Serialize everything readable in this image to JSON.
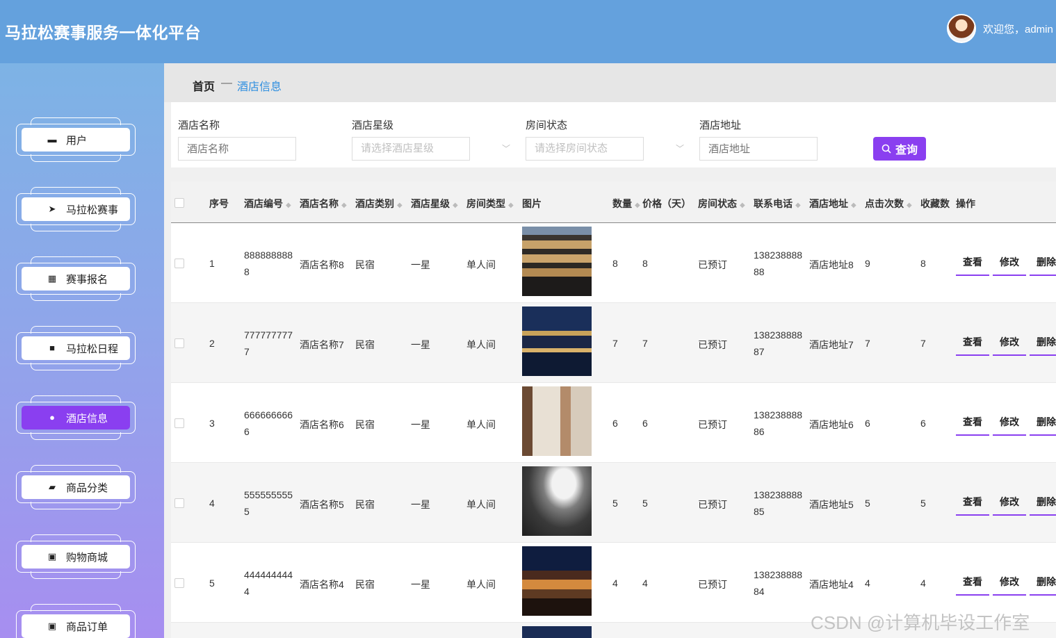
{
  "header": {
    "title": "马拉松赛事服务一体化平台",
    "welcome": "欢迎您，admin"
  },
  "sidebar": {
    "items": [
      {
        "label": "用户",
        "icon": "user-card-icon"
      },
      {
        "label": "马拉松赛事",
        "icon": "paper-plane-icon"
      },
      {
        "label": "赛事报名",
        "icon": "grid-icon"
      },
      {
        "label": "马拉松日程",
        "icon": "four-squares-icon"
      },
      {
        "label": "酒店信息",
        "icon": "person-icon",
        "active": true
      },
      {
        "label": "商品分类",
        "icon": "wallet-icon"
      },
      {
        "label": "购物商城",
        "icon": "clipboard-x-icon"
      },
      {
        "label": "商品订单",
        "icon": "clipboard-check-icon"
      }
    ]
  },
  "breadcrumb": {
    "home": "首页",
    "separator": "—",
    "current": "酒店信息"
  },
  "search": {
    "name_label": "酒店名称",
    "name_placeholder": "酒店名称",
    "star_label": "酒店星级",
    "star_placeholder": "请选择酒店星级",
    "room_status_label": "房间状态",
    "room_status_placeholder": "请选择房间状态",
    "address_label": "酒店地址",
    "address_placeholder": "酒店地址",
    "query_button": "查询"
  },
  "table": {
    "headers": {
      "index": "序号",
      "code": "酒店编号",
      "name": "酒店名称",
      "category": "酒店类别",
      "star": "酒店星级",
      "room_type": "房间类型",
      "image": "图片",
      "quantity": "数量",
      "price": "价格（天）",
      "room_status": "房间状态",
      "phone": "联系电话",
      "address": "酒店地址",
      "clicks": "点击次数",
      "favorites": "收藏数",
      "actions": "操作"
    },
    "rows": [
      {
        "index": "1",
        "code": "8888888888",
        "name": "酒店名称8",
        "category": "民宿",
        "star": "一星",
        "room_type": "单人间",
        "quantity": "8",
        "price": "8",
        "room_status": "已预订",
        "phone": "13823888888",
        "address": "酒店地址8",
        "clicks": "9",
        "favorites": "8"
      },
      {
        "index": "2",
        "code": "7777777777",
        "name": "酒店名称7",
        "category": "民宿",
        "star": "一星",
        "room_type": "单人间",
        "quantity": "7",
        "price": "7",
        "room_status": "已预订",
        "phone": "13823888887",
        "address": "酒店地址7",
        "clicks": "7",
        "favorites": "7"
      },
      {
        "index": "3",
        "code": "6666666666",
        "name": "酒店名称6",
        "category": "民宿",
        "star": "一星",
        "room_type": "单人间",
        "quantity": "6",
        "price": "6",
        "room_status": "已预订",
        "phone": "13823888886",
        "address": "酒店地址6",
        "clicks": "6",
        "favorites": "6"
      },
      {
        "index": "4",
        "code": "5555555555",
        "name": "酒店名称5",
        "category": "民宿",
        "star": "一星",
        "room_type": "单人间",
        "quantity": "5",
        "price": "5",
        "room_status": "已预订",
        "phone": "13823888885",
        "address": "酒店地址5",
        "clicks": "5",
        "favorites": "5"
      },
      {
        "index": "5",
        "code": "4444444444",
        "name": "酒店名称4",
        "category": "民宿",
        "star": "一星",
        "room_type": "单人间",
        "quantity": "4",
        "price": "4",
        "room_status": "已预订",
        "phone": "13823888884",
        "address": "酒店地址4",
        "clicks": "4",
        "favorites": "4"
      }
    ],
    "actions": {
      "view": "查看",
      "edit": "修改",
      "delete": "删除"
    }
  },
  "watermark": "CSDN @计算机毕设工作室",
  "colors": {
    "header_bg": "#64a1dd",
    "accent": "#8a3ff0",
    "link": "#2f8fe0"
  }
}
